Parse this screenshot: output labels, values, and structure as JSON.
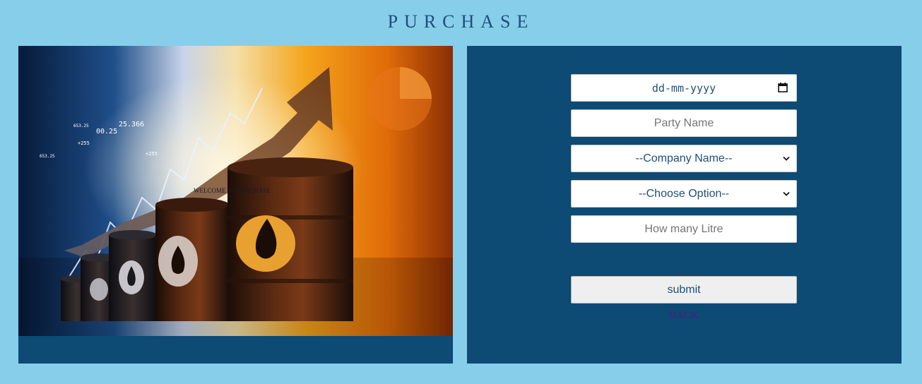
{
  "page": {
    "title": "PURCHASE"
  },
  "hero": {
    "caption": "WELCOME TO PURCHASE"
  },
  "form": {
    "date_placeholder": "dd-mm-yyyy",
    "party_placeholder": "Party Name",
    "company_select": "--Company Name--",
    "option_select": "--Choose Option--",
    "litre_placeholder": "How many Litre",
    "submit_label": "submit",
    "back_label": "BACK"
  },
  "hero_numbers": [
    "25.366",
    "00.25",
    "+255",
    "+255",
    "653.25",
    "653.25"
  ],
  "colors": {
    "page_bg": "#87ceeb",
    "panel_bg": "#0d4a74",
    "title": "#1e4f7a",
    "link": "#4a1f7a"
  },
  "icons": [
    "calendar-icon",
    "chevron-down-icon",
    "oil-drop-icon"
  ]
}
